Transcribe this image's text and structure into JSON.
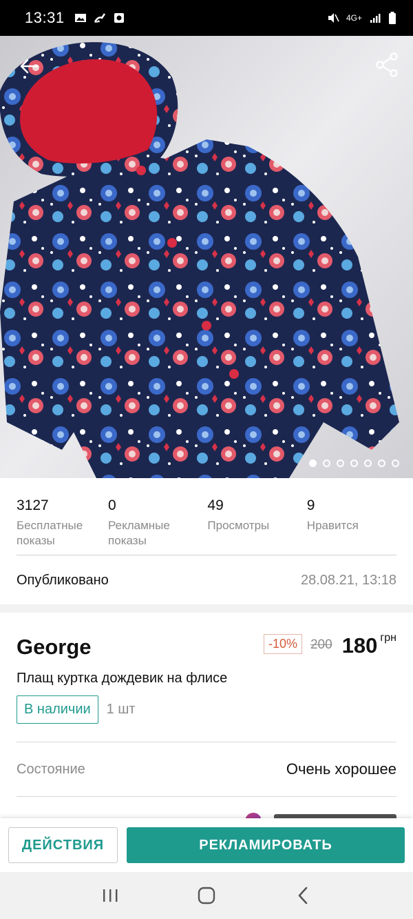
{
  "status_bar": {
    "time": "13:31",
    "network": "4G+",
    "icons": [
      "gallery-icon",
      "broom-icon",
      "record-icon",
      "mute-icon",
      "signal-icon",
      "battery-icon"
    ]
  },
  "hero": {
    "image_alt": "",
    "dots_total": 7,
    "dots_active_index": 0
  },
  "stats": [
    {
      "num": "3127",
      "label": "Бесплатные показы"
    },
    {
      "num": "0",
      "label": "Рекламные показы"
    },
    {
      "num": "49",
      "label": "Просмотры"
    },
    {
      "num": "9",
      "label": "Нравится"
    }
  ],
  "published": {
    "label": "Опубликовано",
    "value": "28.08.21, 13:18"
  },
  "product": {
    "brand": "George",
    "discount": "-10%",
    "old_price": "200",
    "new_price": "180",
    "currency": "грн",
    "title": "Плащ куртка дождевик на флисе",
    "availability": "В наличии",
    "quantity": "1 шт"
  },
  "condition": {
    "label": "Состояние",
    "value": "Очень хорошее"
  },
  "actions": {
    "actions_label": "ДЕЙСТВИЯ",
    "promote_label": "РЕКЛАМИРОВАТЬ"
  },
  "colors": {
    "accent": "#1f9b8e",
    "discount": "#d55a3c",
    "muted_text": "#8a8a8a"
  }
}
